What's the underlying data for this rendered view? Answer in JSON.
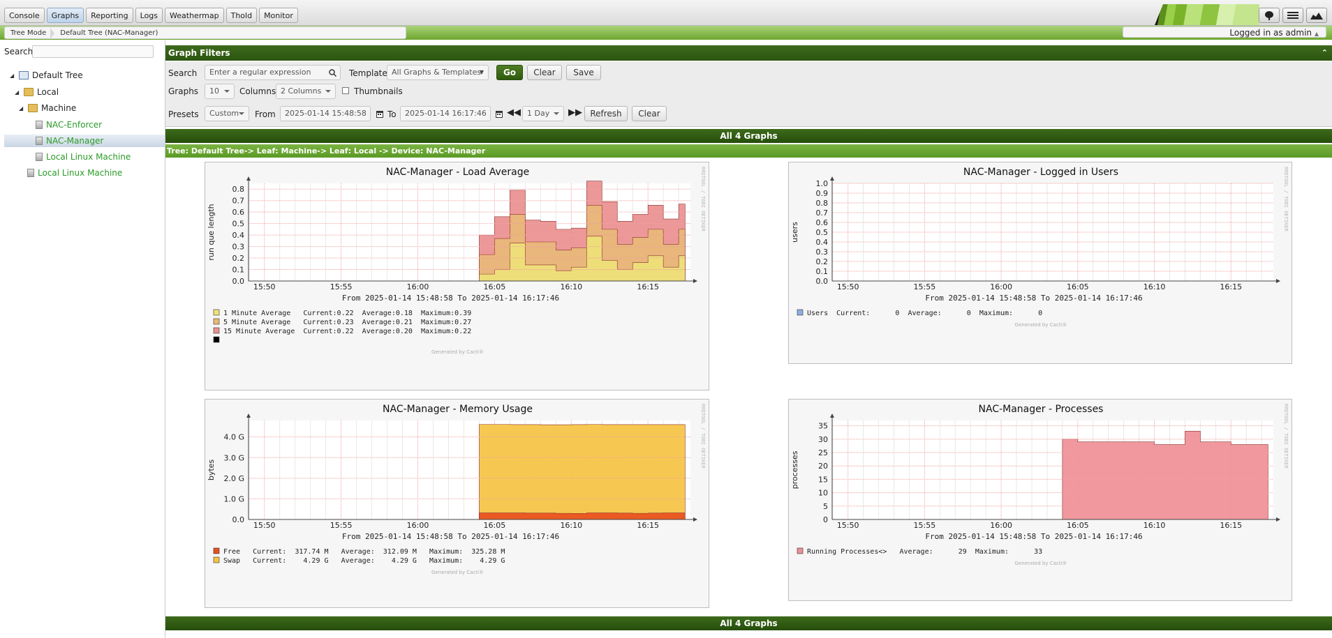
{
  "nav": {
    "tabs": [
      "Console",
      "Graphs",
      "Reporting",
      "Logs",
      "Weathermap",
      "Thold",
      "Monitor"
    ],
    "active_tab": "Graphs"
  },
  "breadcrumb": {
    "mode": "Tree Mode",
    "path": "Default Tree (NAC-Manager)"
  },
  "user": {
    "logged_in_text": "Logged in as admin"
  },
  "tree": {
    "search_label": "Search",
    "root": "Default Tree",
    "local": "Local",
    "machine": "Machine",
    "nac_enforcer": "NAC-Enforcer",
    "nac_manager": "NAC-Manager",
    "local_linux_1": "Local Linux Machine",
    "local_linux_2": "Local Linux Machine"
  },
  "filters": {
    "title": "Graph Filters",
    "search_label": "Search",
    "search_placeholder": "Enter a regular expression",
    "template_label": "Template",
    "template_value": "All Graphs & Templates",
    "go": "Go",
    "clear": "Clear",
    "save": "Save",
    "graphs_label": "Graphs",
    "graphs_value": "10",
    "columns_label": "Columns",
    "columns_value": "2 Columns",
    "thumbnails_label": "Thumbnails",
    "presets_label": "Presets",
    "presets_value": "Custom",
    "from_label": "From",
    "from_value": "2025-01-14 15:48:58",
    "to_label": "To",
    "to_value": "2025-01-14 16:17:46",
    "span_value": "1 Day",
    "refresh": "Refresh",
    "clear2": "Clear"
  },
  "section": {
    "all_graphs": "All 4 Graphs",
    "tree_path": "Tree: Default Tree-> Leaf: Machine-> Leaf: Local -> Device: NAC-Manager"
  },
  "graph_common": {
    "time_range": "From 2025-01-14 15:48:58 To 2025-01-14 16:17:46",
    "generated": "Generated by Cacti®",
    "side": "RRDTOOL / TOBI OETIKER",
    "x_ticks": [
      "15:50",
      "15:55",
      "16:00",
      "16:05",
      "16:10",
      "16:15"
    ]
  },
  "chart_data": [
    {
      "type": "area",
      "title": "NAC-Manager - Load Average",
      "ylabel": "run que length",
      "ylim": [
        0,
        0.85
      ],
      "y_ticks": [
        "0.0",
        "0.1",
        "0.2",
        "0.3",
        "0.4",
        "0.5",
        "0.6",
        "0.7",
        "0.8"
      ],
      "x": [
        "16:04",
        "16:05",
        "16:06",
        "16:07",
        "16:08",
        "16:09",
        "16:10",
        "16:11",
        "16:12",
        "16:13",
        "16:14",
        "16:15",
        "16:16",
        "16:17"
      ],
      "series": [
        {
          "name": "1 Minute Average",
          "color": "#eee27a",
          "values": [
            0.06,
            0.1,
            0.33,
            0.14,
            0.14,
            0.09,
            0.12,
            0.39,
            0.18,
            0.1,
            0.16,
            0.22,
            0.12,
            0.22
          ]
        },
        {
          "name": "5 Minute Average",
          "color": "#e8b878",
          "values": [
            0.23,
            0.37,
            0.58,
            0.34,
            0.34,
            0.27,
            0.29,
            0.66,
            0.45,
            0.32,
            0.38,
            0.45,
            0.32,
            0.45
          ]
        },
        {
          "name": "15 Minute Average",
          "color": "#ea8f8f",
          "values": [
            0.4,
            0.56,
            0.79,
            0.53,
            0.52,
            0.45,
            0.46,
            0.87,
            0.69,
            0.52,
            0.58,
            0.66,
            0.54,
            0.67
          ]
        }
      ],
      "legend": [
        {
          "color": "#eee27a",
          "text": "1 Minute Average   Current:0.22  Average:0.18  Maximum:0.39"
        },
        {
          "color": "#e8b878",
          "text": "5 Minute Average   Current:0.23  Average:0.21  Maximum:0.27"
        },
        {
          "color": "#ea8f8f",
          "text": "15 Minute Average  Current:0.22  Average:0.20  Maximum:0.22"
        },
        {
          "color": "#000000",
          "text": ""
        }
      ]
    },
    {
      "type": "line",
      "title": "NAC-Manager - Logged in Users",
      "ylabel": "users",
      "ylim": [
        0,
        1.0
      ],
      "y_ticks": [
        "0.0",
        "0.1",
        "0.2",
        "0.3",
        "0.4",
        "0.5",
        "0.6",
        "0.7",
        "0.8",
        "0.9",
        "1.0"
      ],
      "series": [
        {
          "name": "Users",
          "color": "#8eaee4",
          "values": []
        }
      ],
      "legend": [
        {
          "color": "#8eaee4",
          "text": "Users  Current:      0  Average:      0  Maximum:      0"
        }
      ]
    },
    {
      "type": "area",
      "title": "NAC-Manager - Memory Usage",
      "ylabel": "bytes",
      "ylim": [
        0,
        4.8
      ],
      "y_ticks": [
        "0.0",
        "1.0 G",
        "2.0 G",
        "3.0 G",
        "4.0 G"
      ],
      "x": [
        "16:04",
        "16:05",
        "16:06",
        "16:07",
        "16:08",
        "16:09",
        "16:10",
        "16:11",
        "16:12",
        "16:13",
        "16:14",
        "16:15",
        "16:16",
        "16:17"
      ],
      "series": [
        {
          "name": "Free",
          "color": "#e8501e",
          "values": [
            0.32,
            0.32,
            0.32,
            0.31,
            0.31,
            0.3,
            0.29,
            0.32,
            0.32,
            0.31,
            0.3,
            0.31,
            0.32,
            0.32
          ]
        },
        {
          "name": "Swap",
          "color": "#f6c342",
          "values": [
            4.61,
            4.61,
            4.6,
            4.6,
            4.59,
            4.59,
            4.6,
            4.61,
            4.6,
            4.6,
            4.6,
            4.6,
            4.6,
            4.6
          ]
        }
      ],
      "legend": [
        {
          "color": "#e8501e",
          "text": "Free   Current:  317.74 M   Average:  312.09 M   Maximum:  325.28 M"
        },
        {
          "color": "#f6c342",
          "text": "Swap   Current:    4.29 G   Average:    4.29 G   Maximum:    4.29 G"
        }
      ]
    },
    {
      "type": "area",
      "title": "NAC-Manager - Processes",
      "ylabel": "processes",
      "ylim": [
        0,
        37
      ],
      "y_ticks": [
        "0",
        "5",
        "10",
        "15",
        "20",
        "25",
        "30",
        "35"
      ],
      "x": [
        "16:04",
        "16:05",
        "16:06",
        "16:07",
        "16:08",
        "16:09",
        "16:10",
        "16:11",
        "16:12",
        "16:13",
        "16:14",
        "16:15",
        "16:16",
        "16:17"
      ],
      "series": [
        {
          "name": "Running Processes<>",
          "color": "#ef8f96",
          "values": [
            30,
            29,
            29,
            29,
            29,
            29,
            28,
            28,
            33,
            29,
            29,
            28,
            28,
            28
          ]
        }
      ],
      "legend": [
        {
          "color": "#ef8f96",
          "text": "Running Processes<>   Average:      29  Maximum:      33"
        }
      ]
    }
  ]
}
